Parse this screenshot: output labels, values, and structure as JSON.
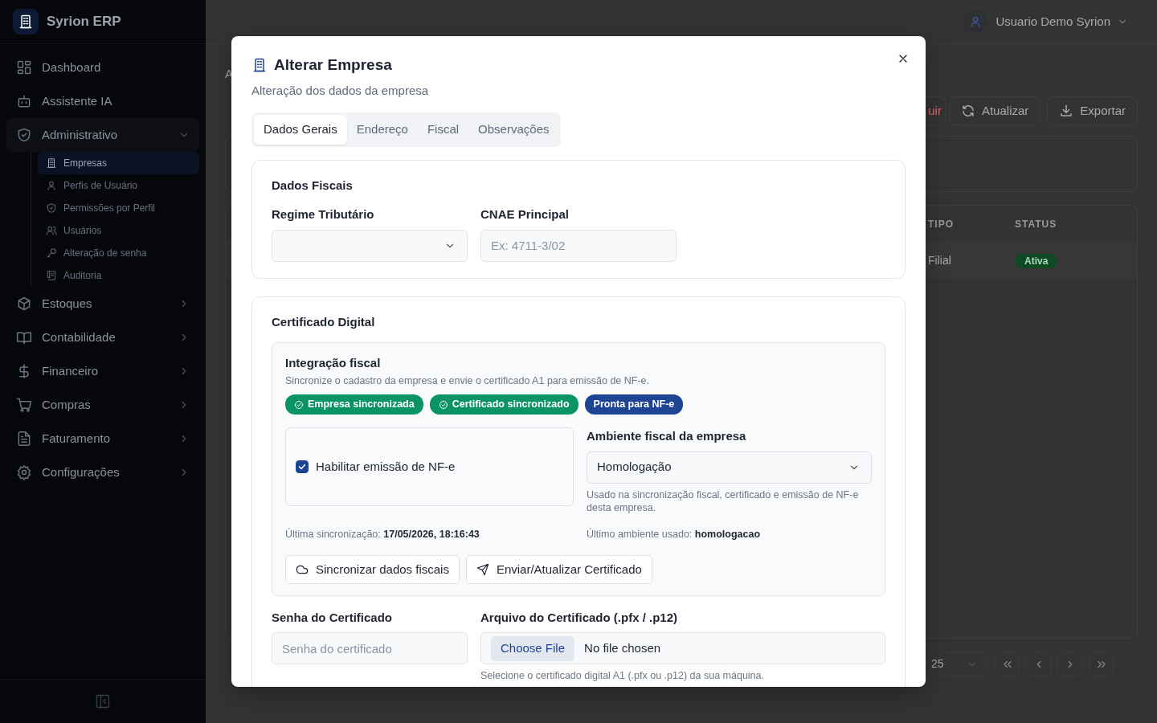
{
  "sidebar": {
    "brand": "Syrion ERP",
    "items": [
      {
        "label": "Dashboard",
        "has_children": false
      },
      {
        "label": "Assistente IA",
        "has_children": false
      },
      {
        "label": "Administrativo",
        "expanded": true,
        "has_children": true,
        "children": [
          {
            "label": "Empresas",
            "selected": true
          },
          {
            "label": "Perfis de Usuário",
            "selected": false
          },
          {
            "label": "Permissões por Perfil",
            "selected": false
          },
          {
            "label": "Usuários",
            "selected": false
          },
          {
            "label": "Alteração de senha",
            "selected": false
          },
          {
            "label": "Auditoria",
            "selected": false
          }
        ]
      },
      {
        "label": "Estoques",
        "expanded": false,
        "has_children": true
      },
      {
        "label": "Contabilidade",
        "expanded": false,
        "has_children": true
      },
      {
        "label": "Financeiro",
        "expanded": false,
        "has_children": true
      },
      {
        "label": "Compras",
        "expanded": false,
        "has_children": true
      },
      {
        "label": "Faturamento",
        "expanded": false,
        "has_children": true
      },
      {
        "label": "Configurações",
        "expanded": false,
        "has_children": true
      }
    ]
  },
  "header": {
    "user": "Usuario Demo Syrion"
  },
  "page": {
    "breadcrumb": "A",
    "toolbar": [
      {
        "label": "uir",
        "kind": "danger"
      },
      {
        "label": "Atualizar",
        "kind": "refresh"
      },
      {
        "label": "Exportar",
        "kind": "export"
      }
    ],
    "table": {
      "columns": [
        "TIPO",
        "STATUS"
      ],
      "rows": [
        [
          "Filial",
          "Ativa"
        ]
      ]
    },
    "page_size": "25"
  },
  "modal": {
    "title": "Alterar Empresa",
    "subtitle": "Alteração dos dados da empresa",
    "tabs": [
      {
        "label": "Dados Gerais",
        "selected": true
      },
      {
        "label": "Endereço",
        "selected": false
      },
      {
        "label": "Fiscal",
        "selected": false
      },
      {
        "label": "Observações",
        "selected": false
      }
    ],
    "dados_fiscais": {
      "title": "Dados Fiscais",
      "regime": {
        "label": "Regime Tributário"
      },
      "cnae": {
        "label": "CNAE Principal",
        "placeholder": "Ex: 4711-3/02"
      }
    },
    "certificado": {
      "title": "Certificado Digital",
      "integracao": {
        "title": "Integração fiscal",
        "description": "Sincronize o cadastro da empresa e envie o certificado A1 para emissão de NF-e.",
        "badges": [
          {
            "text": "Empresa sincronizada",
            "kind": "success"
          },
          {
            "text": "Certificado sincronizado",
            "kind": "success"
          },
          {
            "text": "Pronta para NF-e",
            "kind": "primary"
          }
        ],
        "enable": {
          "label": "Habilitar emissão de NF-e",
          "checked": true
        },
        "ambiente": {
          "label": "Ambiente fiscal da empresa",
          "value": "Homologação",
          "help": "Usado na sincronização fiscal, certificado e emissão de NF-e desta empresa."
        },
        "last_sync": {
          "label": "Última sincronização:",
          "value": "17/05/2026, 18:16:43"
        },
        "last_env": {
          "label": "Último ambiente usado:",
          "value": "homologacao"
        },
        "buttons": [
          {
            "label": "Sincronizar dados fiscais",
            "kind": "cloud"
          },
          {
            "label": "Enviar/Atualizar Certificado",
            "kind": "send"
          }
        ]
      },
      "senha": {
        "label": "Senha do Certificado",
        "placeholder": "Senha do certificado"
      },
      "arquivo": {
        "label": "Arquivo do Certificado (.pfx / .p12)",
        "button": "Choose File",
        "status": "No file chosen",
        "help": "Selecione o certificado digital A1 (.pfx ou .p12) da sua máquina."
      }
    }
  }
}
